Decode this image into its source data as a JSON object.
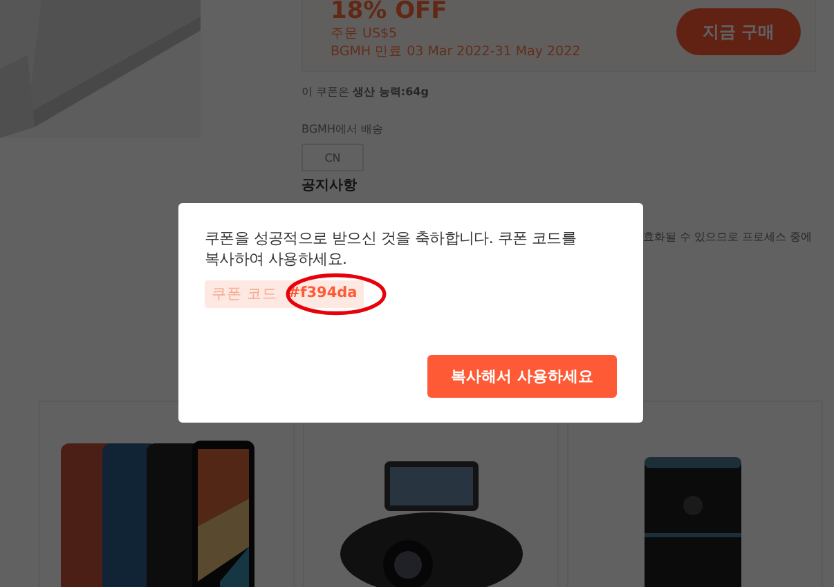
{
  "coupon": {
    "discount": "18% OFF",
    "min_order": "주문 US$5",
    "validity": "BGMH 만료 03 Mar 2022-31 May 2022",
    "buy_button": "지금 구매"
  },
  "applies_to": "이 쿠폰은 **생산 능력:64g**",
  "shipping": {
    "label": "BGMH에서 배송",
    "origin": "CN"
  },
  "notice": {
    "title": "공지사항",
    "text": "효화될 수 있으므로 프로세스 중에"
  },
  "dialog": {
    "message": "쿠폰을 성공적으로 받으신 것을 축하합니다. 쿠폰 코드를 복사하여 사용하세요.",
    "code_label": "쿠폰 코드",
    "code": "#f394da",
    "copy_button": "복사해서 사용하세요"
  }
}
